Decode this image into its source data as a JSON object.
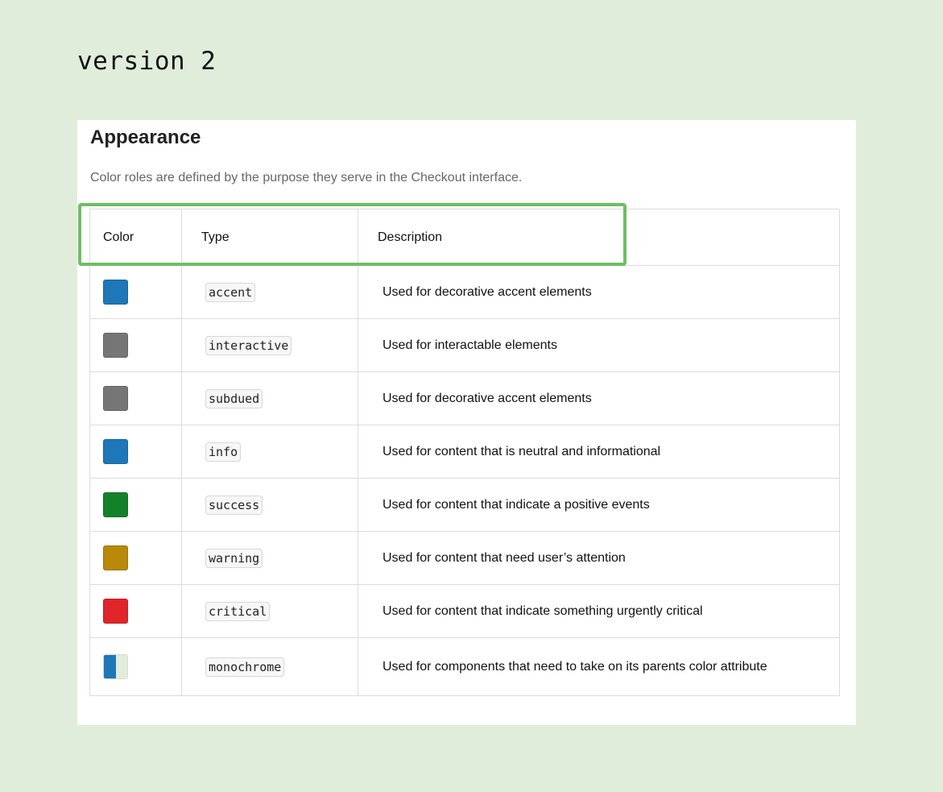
{
  "page": {
    "version_label": "version 2"
  },
  "card": {
    "title": "Appearance",
    "subtitle": "Color roles are defined by the purpose they serve in the Checkout interface."
  },
  "table": {
    "headers": {
      "color": "Color",
      "type": "Type",
      "description": "Description"
    },
    "rows": [
      {
        "type": "accent",
        "description": "Used for decorative accent elements",
        "color": "#1d77b9"
      },
      {
        "type": "interactive",
        "description": "Used for interactable elements",
        "color": "#767676"
      },
      {
        "type": "subdued",
        "description": "Used for decorative accent elements",
        "color": "#767676"
      },
      {
        "type": "info",
        "description": "Used for content that is neutral and informational",
        "color": "#1d77b9"
      },
      {
        "type": "success",
        "description": "Used for content that indicate a positive events",
        "color": "#13812a"
      },
      {
        "type": "warning",
        "description": "Used for content that need user’s attention",
        "color": "#b9890a"
      },
      {
        "type": "critical",
        "description": "Used for content that indicate something urgently critical",
        "color": "#e0252b"
      },
      {
        "type": "monochrome",
        "description": "Used for components that need to take on its parents color attribute",
        "color": "#1d77b9",
        "color_secondary": "#e1eddb"
      }
    ]
  },
  "colors": {
    "background": "#e1eddb",
    "highlight_border": "#6cbf63"
  }
}
